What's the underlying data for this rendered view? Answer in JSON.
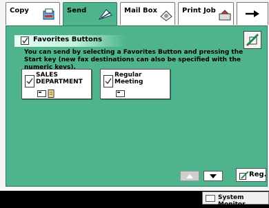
{
  "tabs": [
    {
      "label": "Copy",
      "icon": "copy-icon",
      "active": false
    },
    {
      "label": "Send",
      "icon": "send-icon",
      "active": true
    },
    {
      "label": "Mail Box",
      "icon": "mailbox-icon",
      "active": false
    },
    {
      "label": "Print Job",
      "icon": "printjob-icon",
      "active": false
    }
  ],
  "nav_arrow": {
    "icon": "arrow-right-icon"
  },
  "section": {
    "title": "Favorites Buttons",
    "icon": "favorites-icon"
  },
  "instruction": "You can send by selecting a Favorites Button and pressing the Start key (new fax destinations can also be specified with the numeric keys).",
  "favorites": [
    {
      "line1": "SALES",
      "line2": "DEPARTMENT",
      "icons": [
        "envelope-icon",
        "document-icon"
      ]
    },
    {
      "line1": "Regular",
      "line2": "Meeting",
      "icons": [
        "envelope-icon"
      ]
    }
  ],
  "scroll": {
    "up": "up-arrow-icon",
    "down": "down-arrow-icon",
    "up_enabled": false
  },
  "register_button": {
    "label": "Reg."
  },
  "system_monitor": {
    "label": "System Monitor"
  },
  "colors": {
    "panel": "#4fb48d",
    "accent": "#2e7a5c"
  }
}
